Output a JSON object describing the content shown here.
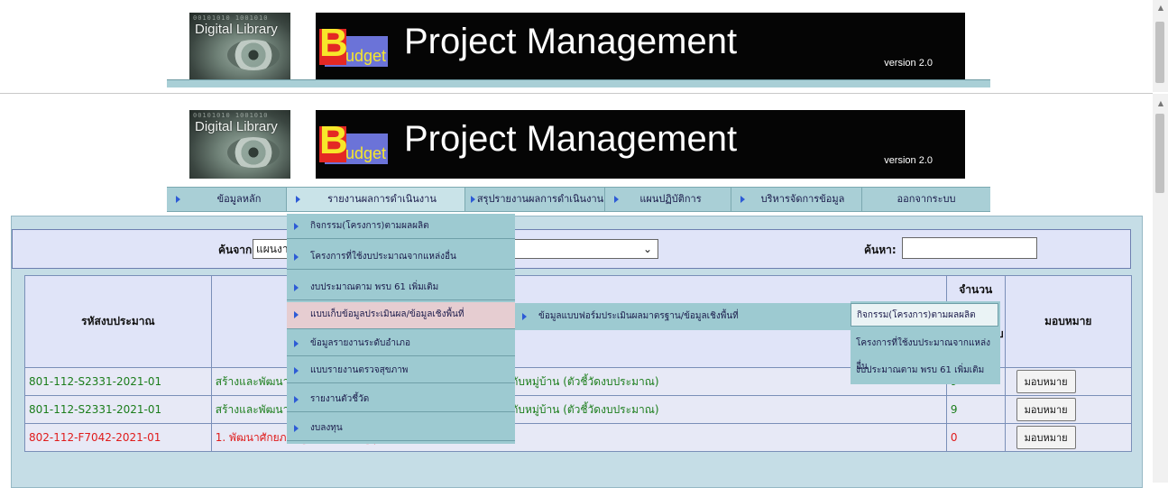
{
  "header": {
    "digital_library": "Digital Library",
    "binary_text": "00101010 1001010",
    "logo_B": "B",
    "logo_udget": "udget",
    "title": "Project Management",
    "version": "version 2.0"
  },
  "nav": {
    "items": [
      {
        "label": "ข้อมูลหลัก"
      },
      {
        "label": "รายงานผลการดำเนินงาน"
      },
      {
        "label": "สรุปรายงานผลการดำเนินงาน"
      },
      {
        "label": "แผนปฏิบัติการ"
      },
      {
        "label": "บริหารจัดการข้อมูล"
      },
      {
        "label": "ออกจากระบบ"
      }
    ]
  },
  "search": {
    "from_label": "ค้นจาก",
    "from_value": "แผนงา",
    "find_label": "ค้นหา:",
    "find_value": ""
  },
  "table": {
    "headers": {
      "code": "รหัสงบประมาณ",
      "count_line1": "จำนวน",
      "count_line2": "บ",
      "assign": "มอบหมาย"
    },
    "rows": [
      {
        "code": "801-112-S2331-2021-01",
        "desc_left": "สร้างและพัฒนาผู้",
        "desc_right": "นระดับหมู่บ้าน (ตัวชี้วัดงบประมาณ)",
        "count": "9",
        "button": "มอบหมาย",
        "status": "green"
      },
      {
        "code": "801-112-S2331-2021-01",
        "desc_left": "สร้างและพัฒนาผู้",
        "desc_right": "นระดับหมู่บ้าน (ตัวชี้วัดงบประมาณ)",
        "count": "9",
        "button": "มอบหมาย",
        "status": "green"
      },
      {
        "code": "802-112-F7042-2021-01",
        "desc_left": "1. พัฒนาศักยภาพผู้ประกอบการสู่ยุค 4.0",
        "desc_right": "",
        "count": "0",
        "button": "มอบหมาย",
        "status": "red"
      }
    ]
  },
  "dropdown": {
    "items": [
      {
        "label": "กิจกรรม(โครงการ)ตามผลผลิต"
      },
      {
        "label": "โครงการที่ใช้งบประมาณจากแหล่งอื่น"
      },
      {
        "label": "งบประมาณตาม พรบ 61 เพิ่มเติม"
      },
      {
        "label": "แบบเก็บข้อมูลประเมินผล/ข้อมูลเชิงพื้นที่"
      },
      {
        "label": "ข้อมูลรายงานระดับอำเภอ"
      },
      {
        "label": "แบบรายงานตรวจสุขภาพ"
      },
      {
        "label": "รายงานตัวชี้วัด"
      },
      {
        "label": "งบลงทุน"
      }
    ],
    "submenu_label": "ข้อมูลแบบฟอร์มประเมินผลมาตรฐาน/ข้อมูลเชิงพื้นที่",
    "submenu2": [
      {
        "label": "กิจกรรม(โครงการ)ตามผลผลิต"
      },
      {
        "label": "โครงการที่ใช้งบประมาณจากแหล่งอื่น"
      },
      {
        "label": "งบประมาณตาม พรบ 61 เพิ่มเติม"
      }
    ]
  },
  "colors": {
    "nav_bg": "#a9cfd6",
    "menu_bg": "#9dcad1",
    "highlight": "#e6cdd1",
    "green_text": "#1b7d1b",
    "red_text": "#e01b1b"
  }
}
